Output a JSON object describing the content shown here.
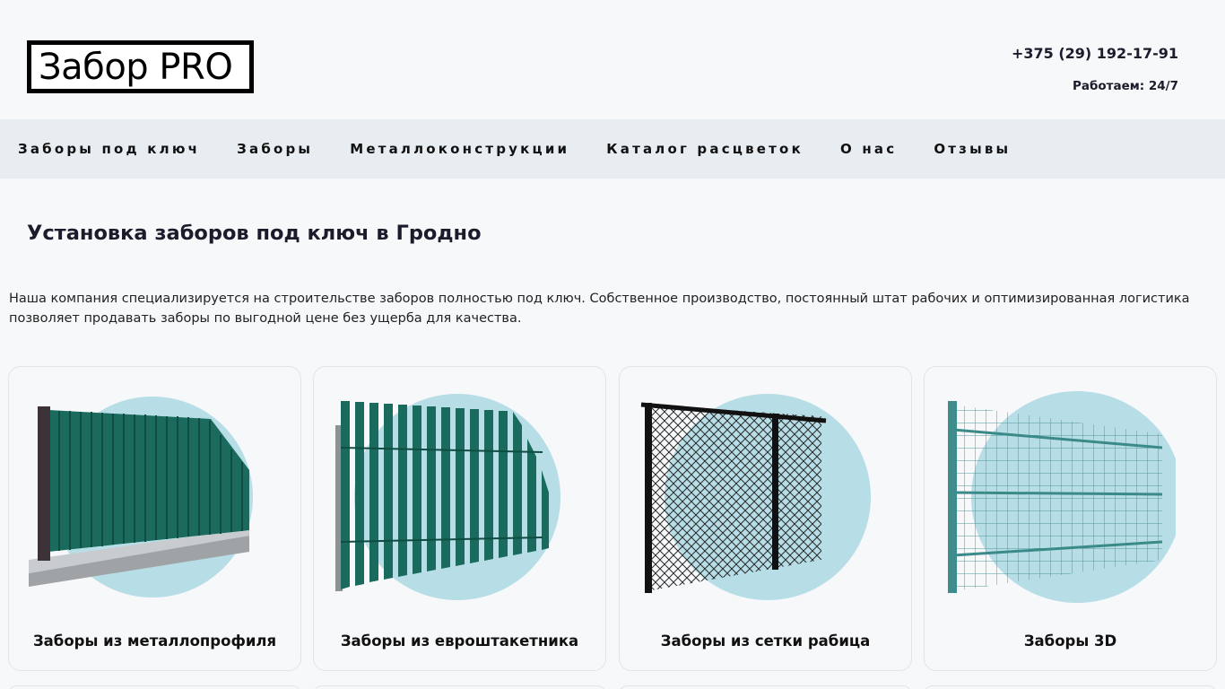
{
  "header": {
    "logo_text": "Забор PRO",
    "phone": "+375 (29) 192-17-91",
    "hours": "Работаем: 24/7"
  },
  "nav": {
    "items": [
      {
        "label": "Заборы под ключ"
      },
      {
        "label": "Заборы"
      },
      {
        "label": "Металлоконструкции"
      },
      {
        "label": "Каталог расцветок"
      },
      {
        "label": "О нас"
      },
      {
        "label": "Отзывы"
      }
    ]
  },
  "main": {
    "title": "Установка заборов под ключ в Гродно",
    "intro": "Наша компания специализируется на строительстве заборов полностью под ключ. Собственное производство, постоянный штат рабочих и оптимизированная логистика позволяет продавать заборы по выгодной цене без ущерба для качества.",
    "cards": [
      {
        "label": "Заборы из металлопрофиля",
        "icon": "metal-profile-fence-image"
      },
      {
        "label": "Заборы из евроштакетника",
        "icon": "picket-fence-image"
      },
      {
        "label": "Заборы из сетки рабица",
        "icon": "chain-link-fence-image"
      },
      {
        "label": "Заборы 3D",
        "icon": "3d-panel-fence-image"
      }
    ]
  },
  "colors": {
    "background": "#f6f8fa",
    "nav_bg": "#e8edf1",
    "fence_green": "#1a6b5e",
    "circle_blue": "#b7dde6",
    "text_dark": "#1b1b2b"
  }
}
